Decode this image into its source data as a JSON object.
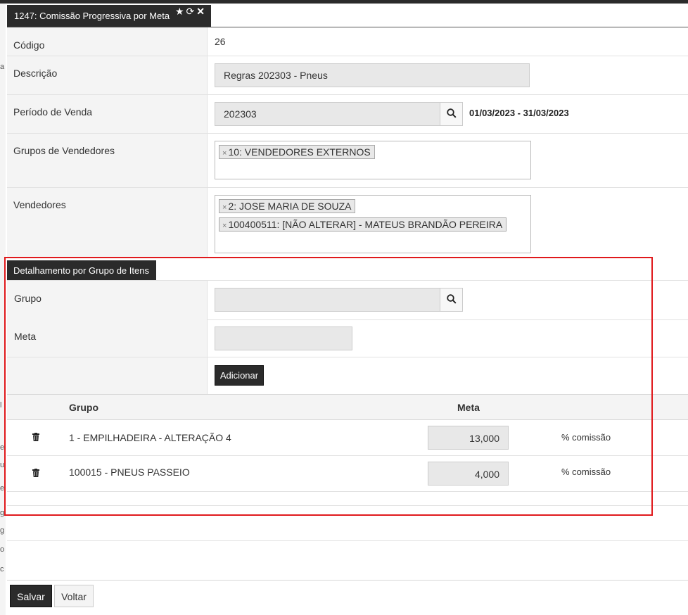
{
  "window": {
    "tab_title": "1247: Comissão Progressiva por Meta",
    "tab_icons": "★ ⟳ ✕"
  },
  "form": {
    "codigo": {
      "label": "Código",
      "value": "26"
    },
    "descricao": {
      "label": "Descrição",
      "value": "Regras 202303 - Pneus"
    },
    "periodo": {
      "label": "Período de Venda",
      "value": "202303",
      "range": "01/03/2023 - 31/03/2023"
    },
    "grupos_vendedores": {
      "label": "Grupos de Vendedores",
      "tags": [
        "10: VENDEDORES EXTERNOS"
      ]
    },
    "vendedores": {
      "label": "Vendedores",
      "tags": [
        "2: JOSE MARIA DE SOUZA",
        "100400511: [NÃO ALTERAR] - MATEUS BRANDÃO PEREIRA"
      ]
    }
  },
  "detail_section": {
    "title": "Detalhamento por Grupo de Itens",
    "grupo": {
      "label": "Grupo",
      "value": ""
    },
    "meta": {
      "label": "Meta",
      "value": ""
    },
    "add_button": "Adicionar",
    "table": {
      "headers": {
        "grupo": "Grupo",
        "meta": "Meta"
      },
      "rows": [
        {
          "grupo": "1 - EMPILHADEIRA - ALTERAÇÃO 4",
          "meta": "13,000",
          "unit": "% comissão"
        },
        {
          "grupo": "100015 - PNEUS PASSEIO",
          "meta": "4,000",
          "unit": "% comissão"
        }
      ]
    }
  },
  "footer": {
    "save": "Salvar",
    "back": "Voltar"
  },
  "left_edge_chars": [
    "a",
    "l",
    "e",
    "u",
    "e",
    "g",
    "g",
    "o",
    "c"
  ],
  "colors": {
    "dark": "#2b2b2b",
    "highlight": "#e0191c",
    "field_bg": "#e8e8e8",
    "label_bg": "#f4f4f4"
  }
}
